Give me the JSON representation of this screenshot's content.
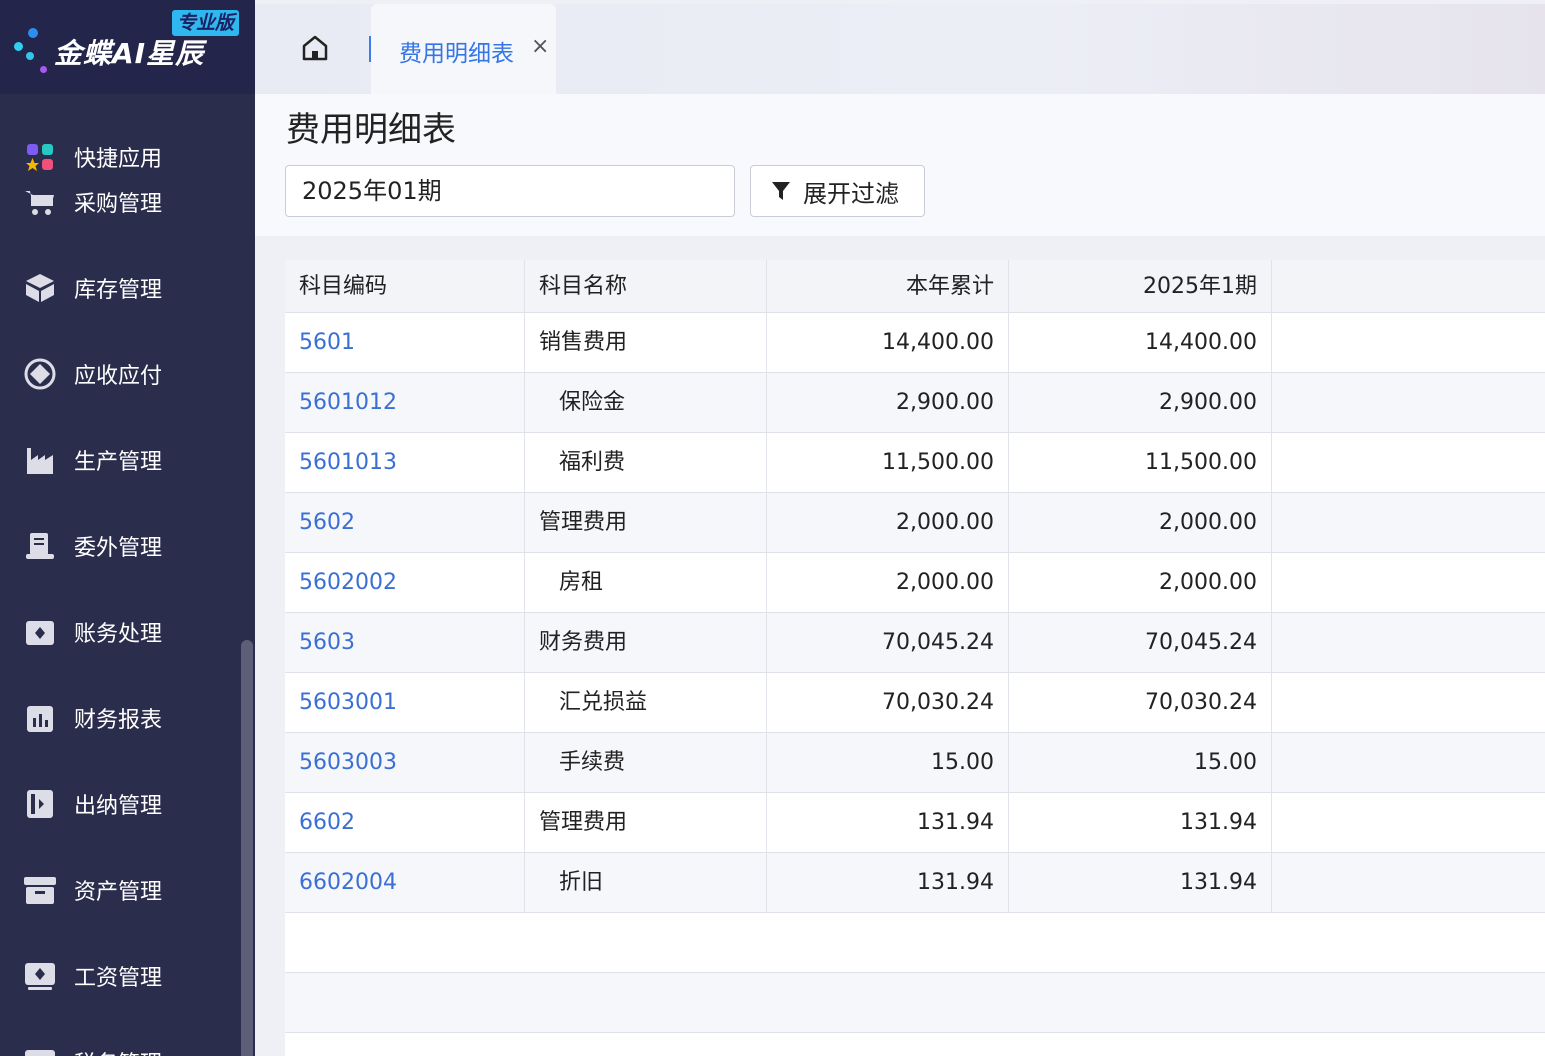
{
  "app": {
    "name": "金蝶AI星辰",
    "edition": "专业版"
  },
  "sidebar": {
    "items": [
      {
        "label": "快捷应用",
        "icon": "apps-grid-icon"
      },
      {
        "label": "采购管理",
        "icon": "cart-icon"
      },
      {
        "label": "库存管理",
        "icon": "box-icon"
      },
      {
        "label": "应收应付",
        "icon": "exchange-icon"
      },
      {
        "label": "生产管理",
        "icon": "factory-icon"
      },
      {
        "label": "委外管理",
        "icon": "outsource-icon"
      },
      {
        "label": "账务处理",
        "icon": "ledger-icon"
      },
      {
        "label": "财务报表",
        "icon": "report-icon"
      },
      {
        "label": "出纳管理",
        "icon": "cashier-icon"
      },
      {
        "label": "资产管理",
        "icon": "asset-icon"
      },
      {
        "label": "工资管理",
        "icon": "salary-icon"
      },
      {
        "label": "税务管理",
        "icon": "tax-icon"
      }
    ]
  },
  "tabs": {
    "active_label": "费用明细表",
    "close_glyph": "×"
  },
  "page": {
    "title": "费用明细表",
    "period_value": "2025年01期",
    "filter_label": "展开过滤"
  },
  "table": {
    "headers": [
      "科目编码",
      "科目名称",
      "本年累计",
      "2025年1期"
    ],
    "rows": [
      {
        "code": "5601",
        "name": "销售费用",
        "year": "14,400.00",
        "p1": "14,400.00",
        "sub": false
      },
      {
        "code": "5601012",
        "name": "保险金",
        "year": "2,900.00",
        "p1": "2,900.00",
        "sub": true
      },
      {
        "code": "5601013",
        "name": "福利费",
        "year": "11,500.00",
        "p1": "11,500.00",
        "sub": true
      },
      {
        "code": "5602",
        "name": "管理费用",
        "year": "2,000.00",
        "p1": "2,000.00",
        "sub": false
      },
      {
        "code": "5602002",
        "name": "房租",
        "year": "2,000.00",
        "p1": "2,000.00",
        "sub": true
      },
      {
        "code": "5603",
        "name": "财务费用",
        "year": "70,045.24",
        "p1": "70,045.24",
        "sub": false
      },
      {
        "code": "5603001",
        "name": "汇兑损益",
        "year": "70,030.24",
        "p1": "70,030.24",
        "sub": true
      },
      {
        "code": "5603003",
        "name": "手续费",
        "year": "15.00",
        "p1": "15.00",
        "sub": true
      },
      {
        "code": "6602",
        "name": "管理费用",
        "year": "131.94",
        "p1": "131.94",
        "sub": false
      },
      {
        "code": "6602004",
        "name": "折旧",
        "year": "131.94",
        "p1": "131.94",
        "sub": true
      }
    ]
  },
  "colors": {
    "accent": "#3576e6",
    "sidebar_bg": "#2b2d4c",
    "link": "#3a6fd4"
  }
}
